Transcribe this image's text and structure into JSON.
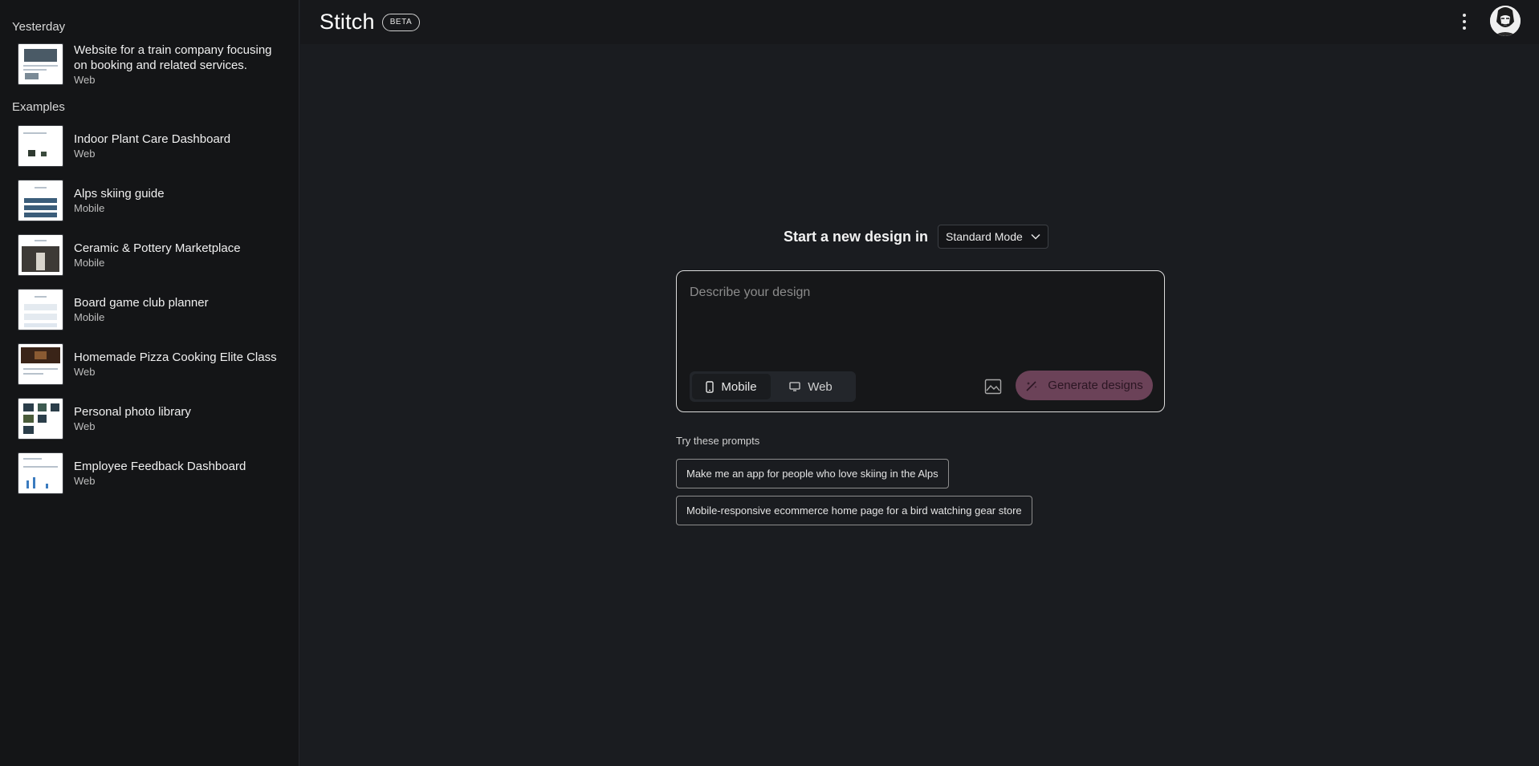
{
  "app": {
    "name": "Stitch",
    "badge": "BETA"
  },
  "sidebar": {
    "yesterday_label": "Yesterday",
    "yesterday_items": [
      {
        "title_line1": "Website for a train company focusing",
        "title_line2": "on booking and related services.",
        "type": "Web"
      }
    ],
    "examples_label": "Examples",
    "examples": [
      {
        "title": "Indoor Plant Care Dashboard",
        "type": "Web"
      },
      {
        "title": "Alps skiing guide",
        "type": "Mobile"
      },
      {
        "title": "Ceramic & Pottery Marketplace",
        "type": "Mobile"
      },
      {
        "title": "Board game club planner",
        "type": "Mobile"
      },
      {
        "title": "Homemade Pizza Cooking Elite Class",
        "type": "Web"
      },
      {
        "title": "Personal photo library",
        "type": "Web"
      },
      {
        "title": "Employee Feedback Dashboard",
        "type": "Web"
      }
    ]
  },
  "header": {
    "menu_icon": "more-vert-icon",
    "avatar_icon": "user-avatar"
  },
  "main": {
    "start_label": "Start a new design in",
    "mode_select": {
      "value": "Standard Mode"
    },
    "prompt": {
      "placeholder": "Describe your design",
      "value": ""
    },
    "platform_toggle": {
      "mobile_label": "Mobile",
      "web_label": "Web",
      "selected": "Mobile"
    },
    "upload_icon": "image-icon",
    "generate_label": "Generate designs",
    "try_label": "Try these prompts",
    "suggestions": [
      "Make me an app for people who love skiing in the Alps",
      "Mobile-responsive ecommerce home page for a bird watching gear store"
    ]
  },
  "colors": {
    "background": "#1a1c20",
    "sidebar": "#141517",
    "generate_button": "#6b4258",
    "border": "#dcdcdc"
  }
}
